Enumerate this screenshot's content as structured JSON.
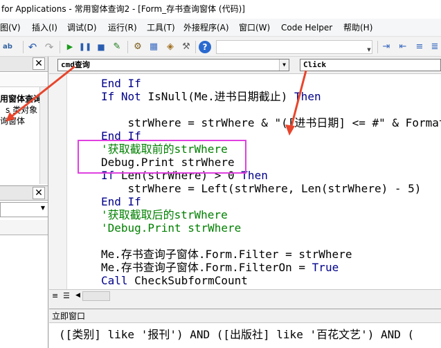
{
  "window": {
    "title": " for Applications - 常用窗体查询2 - [Form_存书查询窗体 (代码)]"
  },
  "menu": [
    "图(V)",
    "插入(I)",
    "调试(D)",
    "运行(R)",
    "工具(T)",
    "外接程序(A)",
    "窗口(W)",
    "Code Helper",
    "帮助(H)"
  ],
  "toolbar": {
    "icons": [
      "abc-icon",
      "undo-icon",
      "redo-icon",
      "run-icon",
      "pause-icon",
      "stop-icon",
      "design-icon",
      "project-explorer-icon",
      "properties-icon",
      "object-browser-icon",
      "toolbox-icon",
      "help-icon",
      "indent-icon",
      "outdent-icon",
      "comment-icon",
      "uncomment-icon"
    ]
  },
  "left_pane": {
    "project_items": [
      "用窗体查询",
      "s 类对象",
      "询窗体"
    ],
    "close_label": "✕"
  },
  "code_window": {
    "object_combo": "cmd查询",
    "procedure_combo": "Click",
    "lines": [
      [
        {
          "t": "End If",
          "c": "kw"
        }
      ],
      [
        {
          "t": "If Not ",
          "c": "kw"
        },
        {
          "t": "IsNull(Me.进书日期截止) ",
          "c": ""
        },
        {
          "t": "Then",
          "c": "kw"
        }
      ],
      [
        {
          "t": "",
          "c": ""
        }
      ],
      [
        {
          "t": "    strWhere = strWhere & \"([进书日期] <= #\" & Format(",
          "c": ""
        }
      ],
      [
        {
          "t": "End If",
          "c": "kw"
        }
      ],
      [
        {
          "t": "'获取截取前的strWhere",
          "c": "cm"
        }
      ],
      [
        {
          "t": "Debug.Print strWhere",
          "c": ""
        }
      ],
      [
        {
          "t": "If ",
          "c": "kw"
        },
        {
          "t": "Len(strWhere) > 0 ",
          "c": ""
        },
        {
          "t": "Then",
          "c": "kw"
        }
      ],
      [
        {
          "t": "    strWhere = Left(strWhere, Len(strWhere) - 5)",
          "c": ""
        }
      ],
      [
        {
          "t": "End If",
          "c": "kw"
        }
      ],
      [
        {
          "t": "'获取截取后的strWhere",
          "c": "cm"
        }
      ],
      [
        {
          "t": "'Debug.Print strWhere",
          "c": "cm"
        }
      ],
      [
        {
          "t": "",
          "c": ""
        }
      ],
      [
        {
          "t": "Me.存书查询子窗体.Form.Filter = strWhere",
          "c": ""
        }
      ],
      [
        {
          "t": "Me.存书查询子窗体.Form.FilterOn = ",
          "c": ""
        },
        {
          "t": "True",
          "c": "kw"
        }
      ],
      [
        {
          "t": "Call ",
          "c": "kw"
        },
        {
          "t": "CheckSubformCount",
          "c": ""
        }
      ]
    ]
  },
  "immediate_window": {
    "title": "立即窗口",
    "output": "([类别] like '报刊') AND ([出版社] like '百花文艺') AND ("
  },
  "colors": {
    "keyword": "#00008b",
    "comment": "#008000",
    "highlight_box": "#e040e0",
    "arrow": "#e8452c"
  }
}
